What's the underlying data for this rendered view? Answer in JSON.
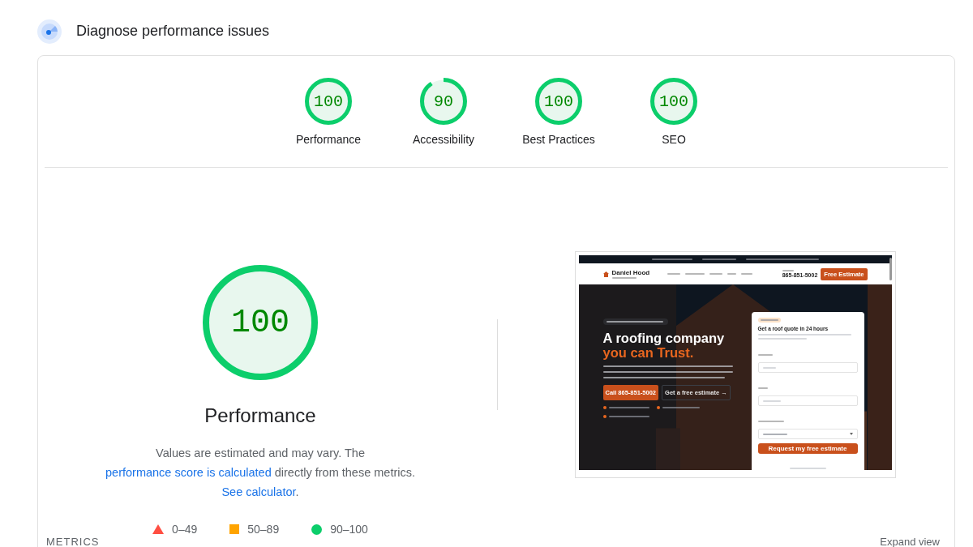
{
  "header": {
    "title": "Diagnose performance issues"
  },
  "categories": [
    {
      "score": "100",
      "label": "Performance"
    },
    {
      "score": "90",
      "label": "Accessibility"
    },
    {
      "score": "100",
      "label": "Best Practices"
    },
    {
      "score": "100",
      "label": "SEO"
    }
  ],
  "performance": {
    "score": "100",
    "title": "Performance",
    "description": [
      {
        "kind": "text",
        "text": "Values are estimated and may vary. The "
      },
      {
        "kind": "link",
        "text": "performance score is calculated"
      },
      {
        "kind": "text",
        "text": " directly from these metrics. "
      },
      {
        "kind": "link",
        "text": "See calculator"
      },
      {
        "kind": "text",
        "text": "."
      }
    ],
    "legend": [
      {
        "kind": "fail",
        "range": "0–49"
      },
      {
        "kind": "average",
        "range": "50–89"
      },
      {
        "kind": "pass",
        "range": "90–100"
      }
    ]
  },
  "screenshot": {
    "brand": {
      "name": "Daniel Hood"
    },
    "call": {
      "number": "865-851-5002"
    },
    "nav_button": "Free Estimate",
    "hero": {
      "title_1": "A roofing company",
      "title_2": "you can Trust.",
      "buttons": [
        {
          "kind": "primary",
          "label": "Call 865-851-5002"
        },
        {
          "kind": "secondary",
          "label": "Get a free estimate →"
        }
      ]
    },
    "form": {
      "title": "Get a roof quote in 24 hours",
      "submit": "Request my free estimate"
    }
  },
  "metrics": {
    "title": "METRICS",
    "action": "Expand view"
  }
}
